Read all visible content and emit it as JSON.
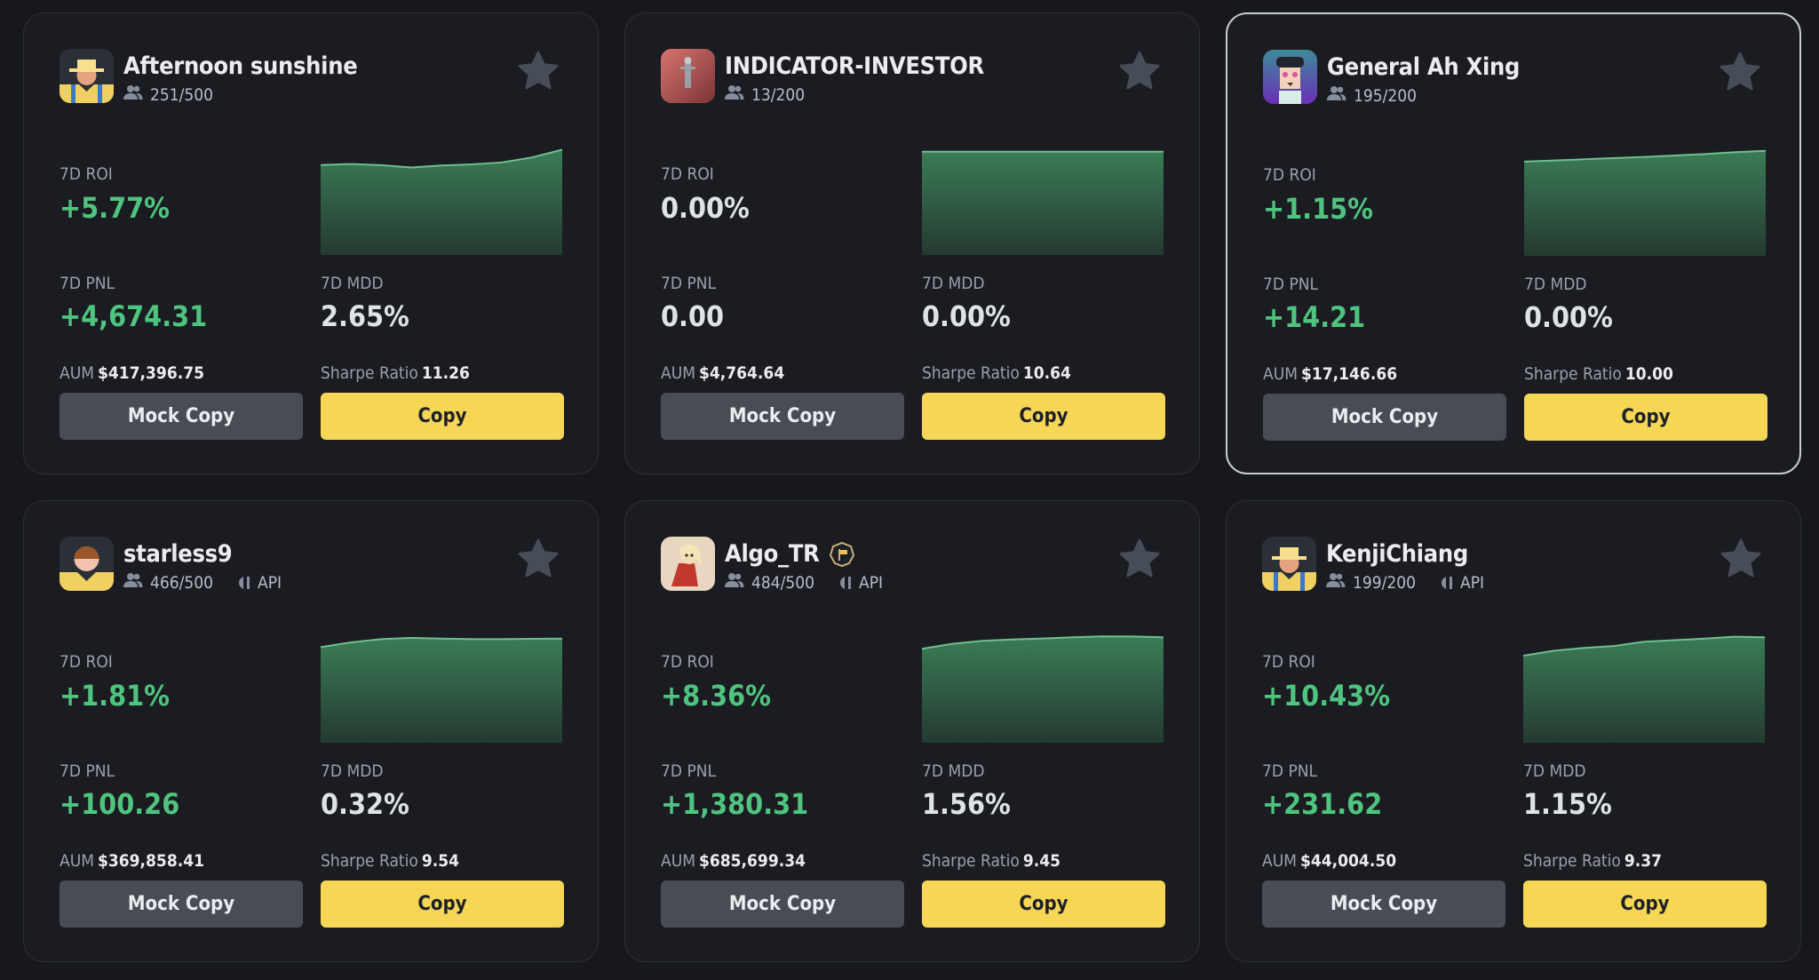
{
  "colors": {
    "background": "#17181c",
    "card": "#1b1c21",
    "positive": "#4fc47f",
    "copy_button": "#f5d655",
    "mock_button": "#474c55",
    "chart_fill": "#3a7a55"
  },
  "labels": {
    "roi": "7D ROI",
    "pnl": "7D PNL",
    "mdd": "7D MDD",
    "aum": "AUM",
    "sharpe": "Sharpe Ratio",
    "mock_copy": "Mock Copy",
    "copy": "Copy",
    "api": "API"
  },
  "cards": [
    {
      "name": "Afternoon sunshine",
      "followers": "251/500",
      "api": false,
      "badge": false,
      "avatar": "farmer-yellow",
      "roi": "+5.77%",
      "roi_positive": true,
      "pnl": "+4,674.31",
      "pnl_positive": true,
      "mdd": "2.65%",
      "aum": "$417,396.75",
      "sharpe": "11.26",
      "highlighted": false,
      "favorite_icon": "star-icon"
    },
    {
      "name": "INDICATOR-INVESTOR",
      "followers": "13/200",
      "api": false,
      "badge": false,
      "avatar": "photo-red",
      "roi": "0.00%",
      "roi_positive": false,
      "pnl": "0.00",
      "pnl_positive": false,
      "mdd": "0.00%",
      "aum": "$4,764.64",
      "sharpe": "10.64",
      "highlighted": false,
      "favorite_icon": "star-icon"
    },
    {
      "name": "General Ah Xing",
      "followers": "195/200",
      "api": false,
      "badge": false,
      "avatar": "general-purple",
      "roi": "+1.15%",
      "roi_positive": true,
      "pnl": "+14.21",
      "pnl_positive": true,
      "mdd": "0.00%",
      "aum": "$17,146.66",
      "sharpe": "10.00",
      "highlighted": true,
      "favorite_icon": "star-icon"
    },
    {
      "name": "starless9",
      "followers": "466/500",
      "api": true,
      "badge": false,
      "avatar": "person-brown",
      "roi": "+1.81%",
      "roi_positive": true,
      "pnl": "+100.26",
      "pnl_positive": true,
      "mdd": "0.32%",
      "aum": "$369,858.41",
      "sharpe": "9.54",
      "highlighted": false,
      "favorite_icon": "star-icon"
    },
    {
      "name": "Algo_TR",
      "followers": "484/500",
      "api": true,
      "badge": true,
      "avatar": "girl-red-cape",
      "roi": "+8.36%",
      "roi_positive": true,
      "pnl": "+1,380.31",
      "pnl_positive": true,
      "mdd": "1.56%",
      "aum": "$685,699.34",
      "sharpe": "9.45",
      "highlighted": false,
      "favorite_icon": "star-icon"
    },
    {
      "name": "KenjiChiang",
      "followers": "199/200",
      "api": true,
      "badge": false,
      "avatar": "farmer-yellow",
      "roi": "+10.43%",
      "roi_positive": true,
      "pnl": "+231.62",
      "pnl_positive": true,
      "mdd": "1.15%",
      "aum": "$44,004.50",
      "sharpe": "9.37",
      "highlighted": false,
      "favorite_icon": "star-icon"
    }
  ],
  "chart_data": [
    {
      "type": "area",
      "title": "Afternoon sunshine 7D ROI",
      "x": [
        0,
        1,
        2,
        3,
        4,
        5,
        6,
        7,
        8
      ],
      "values": [
        0.62,
        0.75,
        0.6,
        0.3,
        0.55,
        0.7,
        0.95,
        1.6,
        2.6
      ],
      "ylim": [
        -11,
        3
      ]
    },
    {
      "type": "area",
      "title": "INDICATOR-INVESTOR 7D ROI",
      "x": [
        0,
        1,
        2,
        3,
        4,
        5,
        6,
        7,
        8
      ],
      "values": [
        0,
        0,
        0,
        0,
        0,
        0,
        0,
        0,
        0
      ],
      "ylim": [
        -10,
        0.5
      ]
    },
    {
      "type": "area",
      "title": "General Ah Xing 7D ROI",
      "x": [
        0,
        1,
        2,
        3,
        4,
        5,
        6,
        7,
        8
      ],
      "values": [
        0,
        0.12,
        0.25,
        0.38,
        0.5,
        0.65,
        0.8,
        1.0,
        1.15
      ],
      "ylim": [
        -10,
        1.5
      ]
    },
    {
      "type": "area",
      "title": "starless9 7D ROI",
      "x": [
        0,
        1,
        2,
        3,
        4,
        5,
        6,
        7,
        8
      ],
      "values": [
        0,
        0.75,
        1.25,
        1.45,
        1.35,
        1.25,
        1.25,
        1.3,
        1.35
      ],
      "ylim": [
        -15,
        2
      ]
    },
    {
      "type": "area",
      "title": "Algo_TR 7D ROI",
      "x": [
        0,
        1,
        2,
        3,
        4,
        5,
        6,
        7,
        8
      ],
      "values": [
        0,
        3.5,
        5.5,
        6.5,
        7.2,
        8.0,
        8.6,
        8.5,
        8.0
      ],
      "ylim": [
        -65,
        10
      ]
    },
    {
      "type": "area",
      "title": "KenjiChiang 7D ROI",
      "x": [
        0,
        1,
        2,
        3,
        4,
        5,
        6,
        7,
        8
      ],
      "values": [
        0,
        2.5,
        4.0,
        5.0,
        7.2,
        8.0,
        8.8,
        9.8,
        9.5
      ],
      "ylim": [
        -45,
        11
      ]
    }
  ]
}
